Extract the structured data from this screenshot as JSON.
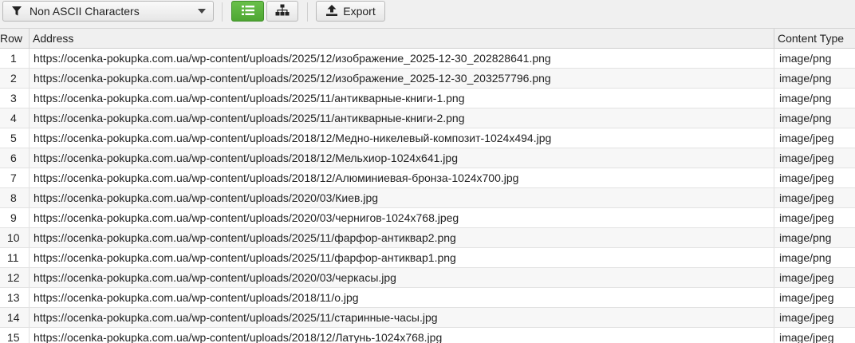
{
  "toolbar": {
    "filter_label": "Non ASCII Characters",
    "export_label": "Export",
    "active_color": "#5bb33d"
  },
  "table": {
    "headers": {
      "row": "Row",
      "address": "Address",
      "content_type": "Content Type"
    },
    "rows": [
      {
        "num": "1",
        "address": "https://ocenka-pokupka.com.ua/wp-content/uploads/2025/12/изображение_2025-12-30_202828641.png",
        "type": "image/png"
      },
      {
        "num": "2",
        "address": "https://ocenka-pokupka.com.ua/wp-content/uploads/2025/12/изображение_2025-12-30_203257796.png",
        "type": "image/png"
      },
      {
        "num": "3",
        "address": "https://ocenka-pokupka.com.ua/wp-content/uploads/2025/11/антикварные-книги-1.png",
        "type": "image/png"
      },
      {
        "num": "4",
        "address": "https://ocenka-pokupka.com.ua/wp-content/uploads/2025/11/антикварные-книги-2.png",
        "type": "image/png"
      },
      {
        "num": "5",
        "address": "https://ocenka-pokupka.com.ua/wp-content/uploads/2018/12/Медно-никелевый-композит-1024x494.jpg",
        "type": "image/jpeg"
      },
      {
        "num": "6",
        "address": "https://ocenka-pokupka.com.ua/wp-content/uploads/2018/12/Мельхиор-1024x641.jpg",
        "type": "image/jpeg"
      },
      {
        "num": "7",
        "address": "https://ocenka-pokupka.com.ua/wp-content/uploads/2018/12/Алюминиевая-бронза-1024x700.jpg",
        "type": "image/jpeg"
      },
      {
        "num": "8",
        "address": "https://ocenka-pokupka.com.ua/wp-content/uploads/2020/03/Киев.jpg",
        "type": "image/jpeg"
      },
      {
        "num": "9",
        "address": "https://ocenka-pokupka.com.ua/wp-content/uploads/2020/03/чернигов-1024x768.jpeg",
        "type": "image/jpeg"
      },
      {
        "num": "10",
        "address": "https://ocenka-pokupka.com.ua/wp-content/uploads/2025/11/фарфор-антиквар2.png",
        "type": "image/png"
      },
      {
        "num": "11",
        "address": "https://ocenka-pokupka.com.ua/wp-content/uploads/2025/11/фарфор-антиквар1.png",
        "type": "image/png"
      },
      {
        "num": "12",
        "address": "https://ocenka-pokupka.com.ua/wp-content/uploads/2020/03/черкасы.jpg",
        "type": "image/jpeg"
      },
      {
        "num": "13",
        "address": "https://ocenka-pokupka.com.ua/wp-content/uploads/2018/11/о.jpg",
        "type": "image/jpeg"
      },
      {
        "num": "14",
        "address": "https://ocenka-pokupka.com.ua/wp-content/uploads/2025/11/старинные-часы.jpg",
        "type": "image/jpeg"
      },
      {
        "num": "15",
        "address": "https://ocenka-pokupka.com.ua/wp-content/uploads/2018/12/Латунь-1024x768.jpg",
        "type": "image/jpeg"
      }
    ]
  }
}
